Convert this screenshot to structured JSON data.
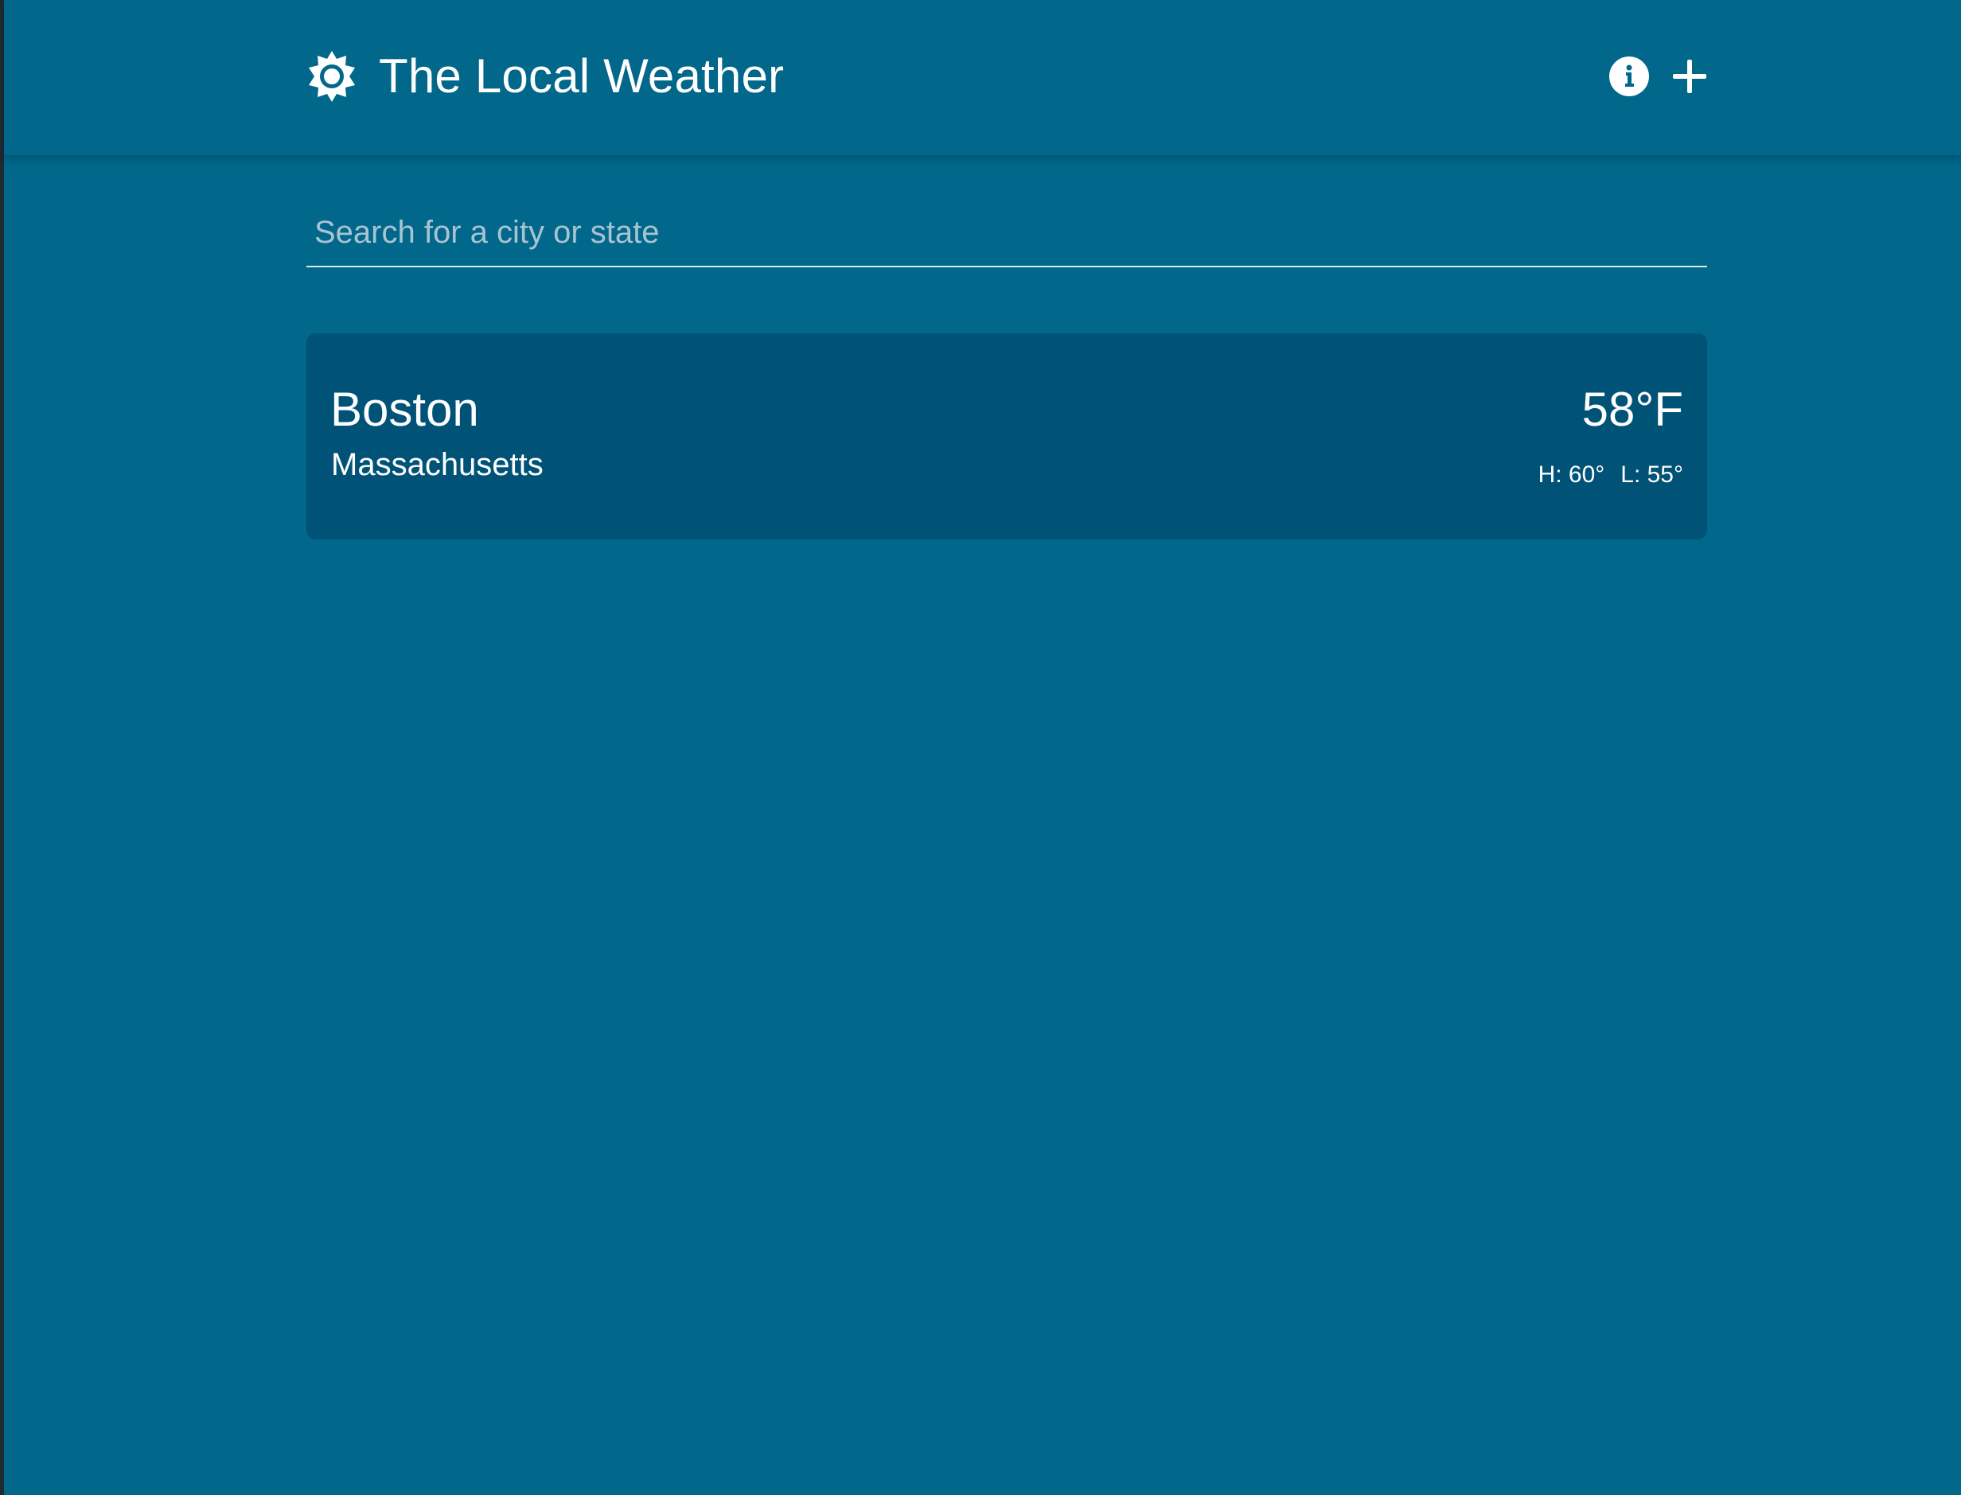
{
  "app": {
    "title": "The Local Weather",
    "logo_icon": "sun-icon",
    "background_color": "#01678b",
    "card_color": "#005277"
  },
  "header": {
    "actions": [
      {
        "icon": "info-icon"
      },
      {
        "icon": "plus-icon"
      }
    ]
  },
  "search": {
    "placeholder": "Search for a city or state",
    "value": ""
  },
  "cities": [
    {
      "city": "Boston",
      "state": "Massachusetts",
      "temperature": "58°F",
      "high": "H: 60°",
      "low": "L: 55°"
    }
  ]
}
